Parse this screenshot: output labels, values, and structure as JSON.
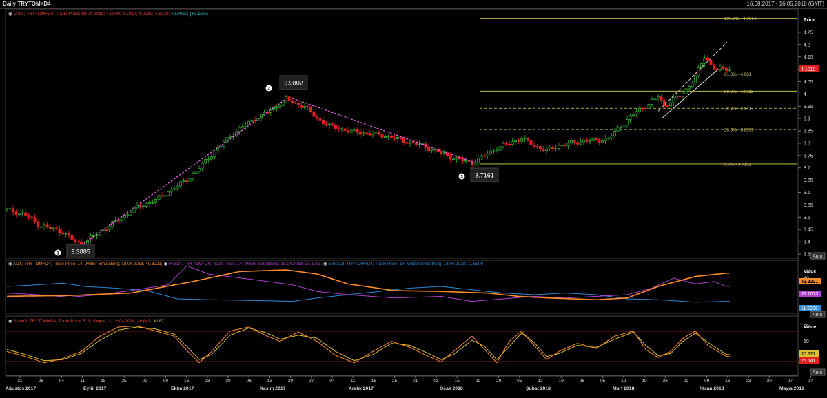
{
  "header": {
    "title": "Daily TRYTOM=D4",
    "date_range": "16.08.2017 - 16.05.2018 (GMT)"
  },
  "colors": {
    "up": "#2fa82f",
    "down": "#e02020",
    "fib_line": "#d8d84a",
    "fib_text": "#ddd070",
    "trend": "#ee66ee",
    "adx": "#ff8c2a",
    "plusdi": "#b040d0",
    "minusdi": "#2f8ad8",
    "stoch_k": "#ff8c2a",
    "stoch_d": "#d8c030",
    "band": "#e84020"
  },
  "panels": {
    "main": {
      "legend_name": "Cndl",
      "legend_text": "; TRYTOM=D4; Trade Price; 18.04.2018; 4.0940; 4.1010; 4.0930; 4.1010;",
      "legend_change": "+0.0060;   (+0.15%)",
      "axis_title": "Price",
      "last_price": "4.1010",
      "auto_label": "Auto"
    },
    "dmi": {
      "legend_adx": "ADX; TRYTOM=D4; Trade Price;   14; Wilder Smoothing;   18.04.2018; 49.8221;",
      "legend_plus": "PlusDI; TRYTOM=D4; Trade Price;   14; Wilder Smoothing;   18.04.2018; 33.1073;",
      "legend_minus": "MinusDI; TRYTOM=D4; Trade Price;   14; Wilder Smoothing;   18.04.2018; 11.5906",
      "axis_title": "Value",
      "adx_value": "49.8221",
      "plus_value": "33.1073",
      "minus_value": "11.5906",
      "auto_label": "Auto"
    },
    "stoch": {
      "legend": "StochS; TRYTOM=D4; Trade Price;   5; 3; Simple;   3;   18.04.2018; 26.641;",
      "legend_extra": "30.821",
      "axis_title": "Value",
      "k_value": "30.821",
      "d_value": "26.641",
      "auto_label": "Auto"
    }
  },
  "annotations": [
    {
      "marker": "1",
      "value": "3.3885"
    },
    {
      "marker": "2",
      "value": "3.9802"
    },
    {
      "marker": "3",
      "value": "3.7161"
    }
  ],
  "chart_data": {
    "type": "candlestick",
    "fib_levels": [
      {
        "label": "100.0%",
        "value": 4.3064,
        "text": "100.0% - 4.3064"
      },
      {
        "label": "61.8%",
        "value": 4.081,
        "text": "61.8% - 4.081"
      },
      {
        "label": "50.0%",
        "value": 4.0113,
        "text": "50.0% - 4.0113"
      },
      {
        "label": "38.2%",
        "value": 3.9417,
        "text": "38.2% - 3.9417"
      },
      {
        "label": "23.6%",
        "value": 3.8555,
        "text": "23.6% - 3.8555"
      },
      {
        "label": "0.0%",
        "value": 3.7162,
        "text": "0.0% - 3.7162"
      }
    ],
    "price_ticks": [
      "4.25",
      "4.2",
      "4.15",
      "4.1",
      "4.05",
      "4",
      "3.95",
      "3.9",
      "3.85",
      "3.8",
      "3.75",
      "3.7",
      "3.65",
      "3.6",
      "3.55",
      "3.5",
      "3.45",
      "3.4",
      "3.35"
    ],
    "price_ylim": [
      3.32,
      4.34
    ],
    "dmi_ticks": [
      "40",
      "20"
    ],
    "stoch_ticks": [
      "90",
      "60",
      "40",
      "20"
    ],
    "day_labels": [
      "21",
      "28",
      "04",
      "11",
      "18",
      "25",
      "02",
      "09",
      "16",
      "23",
      "30",
      "06",
      "13",
      "20",
      "27",
      "04",
      "11",
      "18",
      "25",
      "01",
      "08",
      "15",
      "22",
      "29",
      "05",
      "12",
      "19",
      "26",
      "05",
      "12",
      "19",
      "26",
      "02",
      "09",
      "16",
      "23",
      "30",
      "07",
      "14"
    ],
    "month_labels": [
      "Ağustos 2017",
      "Eylül 2017",
      "Ekim 2017",
      "Kasım 2017",
      "Aralık 2017",
      "Ocak 2018",
      "Şubat 2018",
      "Mart 2018",
      "Nisan 2018",
      "Mayıs 2018"
    ],
    "close_anchors": [
      [
        0,
        3.53
      ],
      [
        6,
        3.51
      ],
      [
        10,
        3.47
      ],
      [
        14,
        3.455
      ],
      [
        18,
        3.44
      ],
      [
        22,
        3.4
      ],
      [
        24,
        3.39
      ],
      [
        30,
        3.44
      ],
      [
        36,
        3.49
      ],
      [
        42,
        3.54
      ],
      [
        48,
        3.57
      ],
      [
        54,
        3.62
      ],
      [
        58,
        3.65
      ],
      [
        62,
        3.7
      ],
      [
        68,
        3.78
      ],
      [
        74,
        3.85
      ],
      [
        80,
        3.9
      ],
      [
        86,
        3.94
      ],
      [
        90,
        3.98
      ],
      [
        93,
        3.96
      ],
      [
        96,
        3.95
      ],
      [
        100,
        3.9
      ],
      [
        104,
        3.87
      ],
      [
        110,
        3.85
      ],
      [
        116,
        3.84
      ],
      [
        122,
        3.83
      ],
      [
        128,
        3.81
      ],
      [
        134,
        3.79
      ],
      [
        140,
        3.76
      ],
      [
        144,
        3.74
      ],
      [
        150,
        3.72
      ],
      [
        154,
        3.75
      ],
      [
        158,
        3.78
      ],
      [
        162,
        3.8
      ],
      [
        166,
        3.82
      ],
      [
        170,
        3.79
      ],
      [
        174,
        3.77
      ],
      [
        178,
        3.79
      ],
      [
        182,
        3.8
      ],
      [
        186,
        3.81
      ],
      [
        190,
        3.81
      ],
      [
        194,
        3.82
      ],
      [
        198,
        3.87
      ],
      [
        202,
        3.92
      ],
      [
        206,
        3.95
      ],
      [
        210,
        3.99
      ],
      [
        212,
        3.95
      ],
      [
        214,
        3.97
      ],
      [
        218,
        4.0
      ],
      [
        222,
        4.07
      ],
      [
        225,
        4.15
      ],
      [
        227,
        4.12
      ],
      [
        229,
        4.1
      ],
      [
        233,
        4.1
      ]
    ],
    "adx_anchors": [
      [
        0,
        18
      ],
      [
        20,
        19
      ],
      [
        40,
        22
      ],
      [
        60,
        36
      ],
      [
        75,
        48
      ],
      [
        90,
        50
      ],
      [
        100,
        45
      ],
      [
        110,
        33
      ],
      [
        125,
        25
      ],
      [
        140,
        24
      ],
      [
        155,
        22
      ],
      [
        165,
        18
      ],
      [
        175,
        16
      ],
      [
        190,
        14
      ],
      [
        200,
        16
      ],
      [
        210,
        30
      ],
      [
        222,
        42
      ],
      [
        232,
        46
      ]
    ],
    "plus_anchors": [
      [
        0,
        22
      ],
      [
        10,
        20
      ],
      [
        20,
        17
      ],
      [
        30,
        20
      ],
      [
        40,
        25
      ],
      [
        52,
        32
      ],
      [
        58,
        55
      ],
      [
        65,
        45
      ],
      [
        80,
        38
      ],
      [
        92,
        32
      ],
      [
        100,
        24
      ],
      [
        110,
        20
      ],
      [
        125,
        16
      ],
      [
        140,
        18
      ],
      [
        150,
        12
      ],
      [
        160,
        15
      ],
      [
        170,
        18
      ],
      [
        180,
        16
      ],
      [
        190,
        18
      ],
      [
        200,
        20
      ],
      [
        208,
        28
      ],
      [
        215,
        40
      ],
      [
        222,
        33
      ],
      [
        228,
        36
      ],
      [
        232,
        30
      ]
    ],
    "minus_anchors": [
      [
        0,
        30
      ],
      [
        10,
        32
      ],
      [
        18,
        34
      ],
      [
        25,
        30
      ],
      [
        35,
        28
      ],
      [
        45,
        25
      ],
      [
        55,
        15
      ],
      [
        65,
        14
      ],
      [
        80,
        13
      ],
      [
        92,
        12
      ],
      [
        100,
        16
      ],
      [
        110,
        20
      ],
      [
        120,
        24
      ],
      [
        130,
        28
      ],
      [
        140,
        30
      ],
      [
        150,
        26
      ],
      [
        160,
        22
      ],
      [
        170,
        20
      ],
      [
        180,
        22
      ],
      [
        190,
        20
      ],
      [
        200,
        15
      ],
      [
        210,
        14
      ],
      [
        222,
        11
      ],
      [
        232,
        12
      ]
    ],
    "stoch_k_anchors": [
      [
        0,
        40
      ],
      [
        6,
        30
      ],
      [
        12,
        18
      ],
      [
        18,
        26
      ],
      [
        24,
        40
      ],
      [
        30,
        70
      ],
      [
        36,
        88
      ],
      [
        42,
        90
      ],
      [
        48,
        80
      ],
      [
        54,
        70
      ],
      [
        58,
        42
      ],
      [
        62,
        18
      ],
      [
        66,
        40
      ],
      [
        72,
        80
      ],
      [
        78,
        88
      ],
      [
        84,
        70
      ],
      [
        88,
        60
      ],
      [
        94,
        78
      ],
      [
        100,
        60
      ],
      [
        106,
        32
      ],
      [
        112,
        18
      ],
      [
        118,
        40
      ],
      [
        124,
        60
      ],
      [
        130,
        48
      ],
      [
        136,
        30
      ],
      [
        140,
        20
      ],
      [
        144,
        40
      ],
      [
        150,
        70
      ],
      [
        154,
        44
      ],
      [
        158,
        18
      ],
      [
        162,
        60
      ],
      [
        166,
        80
      ],
      [
        170,
        52
      ],
      [
        174,
        24
      ],
      [
        178,
        40
      ],
      [
        184,
        56
      ],
      [
        190,
        46
      ],
      [
        196,
        70
      ],
      [
        202,
        80
      ],
      [
        206,
        44
      ],
      [
        210,
        28
      ],
      [
        214,
        40
      ],
      [
        218,
        66
      ],
      [
        222,
        80
      ],
      [
        226,
        52
      ],
      [
        232,
        30
      ]
    ],
    "stoch_d_anchors": [
      [
        0,
        44
      ],
      [
        6,
        34
      ],
      [
        12,
        22
      ],
      [
        18,
        24
      ],
      [
        24,
        36
      ],
      [
        30,
        62
      ],
      [
        36,
        82
      ],
      [
        42,
        88
      ],
      [
        48,
        84
      ],
      [
        54,
        74
      ],
      [
        58,
        50
      ],
      [
        62,
        24
      ],
      [
        66,
        34
      ],
      [
        72,
        72
      ],
      [
        78,
        86
      ],
      [
        84,
        76
      ],
      [
        88,
        64
      ],
      [
        94,
        72
      ],
      [
        100,
        66
      ],
      [
        106,
        40
      ],
      [
        112,
        22
      ],
      [
        118,
        34
      ],
      [
        124,
        56
      ],
      [
        130,
        52
      ],
      [
        136,
        36
      ],
      [
        140,
        24
      ],
      [
        144,
        34
      ],
      [
        150,
        62
      ],
      [
        154,
        50
      ],
      [
        158,
        24
      ],
      [
        162,
        50
      ],
      [
        166,
        76
      ],
      [
        170,
        58
      ],
      [
        174,
        30
      ],
      [
        178,
        36
      ],
      [
        184,
        52
      ],
      [
        190,
        48
      ],
      [
        196,
        64
      ],
      [
        202,
        78
      ],
      [
        206,
        52
      ],
      [
        210,
        32
      ],
      [
        214,
        36
      ],
      [
        218,
        60
      ],
      [
        222,
        76
      ],
      [
        226,
        58
      ],
      [
        232,
        34
      ]
    ]
  }
}
